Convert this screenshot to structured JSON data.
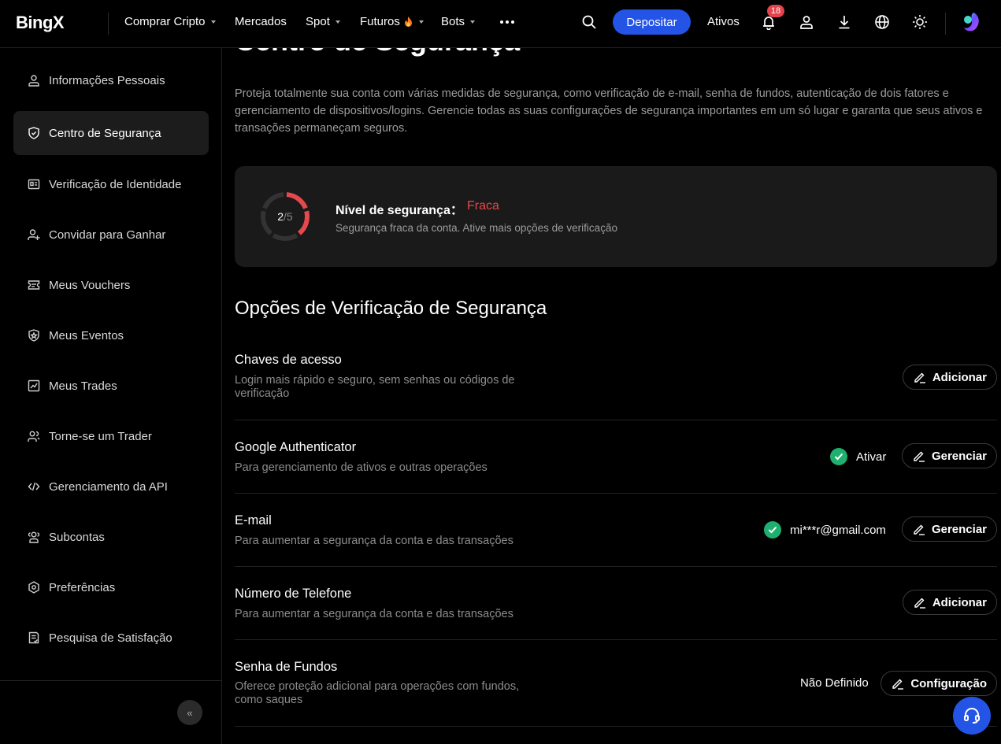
{
  "nav": {
    "logo": "BingX",
    "items": [
      {
        "label": "Comprar Cripto",
        "has_caret": true
      },
      {
        "label": "Mercados",
        "has_caret": false
      },
      {
        "label": "Spot",
        "has_caret": true
      },
      {
        "label": "Futuros",
        "has_caret": true
      },
      {
        "label": "Bots",
        "has_caret": true
      }
    ],
    "more_icon": "more-dots-icon",
    "deposit_label": "Depositar",
    "assets_label": "Ativos",
    "notification_count": "18"
  },
  "sidebar": {
    "items": [
      {
        "label": "Informações Pessoais",
        "icon": "user-icon"
      },
      {
        "label": "Centro de Segurança",
        "icon": "shield-icon",
        "active": true
      },
      {
        "label": "Verificação de Identidade",
        "icon": "id-card-icon"
      },
      {
        "label": "Convidar para Ganhar",
        "icon": "user-plus-icon"
      },
      {
        "label": "Meus Vouchers",
        "icon": "voucher-icon"
      },
      {
        "label": "Meus Eventos",
        "icon": "event-icon"
      },
      {
        "label": "Meus Trades",
        "icon": "chart-icon"
      },
      {
        "label": "Torne-se um Trader",
        "icon": "users-icon"
      },
      {
        "label": "Gerenciamento da API",
        "icon": "code-icon"
      },
      {
        "label": "Subcontas",
        "icon": "subaccount-icon"
      },
      {
        "label": "Preferências",
        "icon": "settings-icon"
      },
      {
        "label": "Pesquisa de Satisfação",
        "icon": "survey-icon"
      }
    ],
    "collapse_label": "«"
  },
  "main": {
    "title": "Centro de Segurança",
    "intro": "Proteja totalmente sua conta com várias medidas de segurança, como verificação de e-mail, senha de fundos, autenticação de dois fatores e gerenciamento de dispositivos/logins. Gerencie todas as suas configurações de segurança importantes em um só lugar e garanta que seus ativos e transações permaneçam seguros.",
    "level": {
      "score": "2",
      "total": "/5",
      "fraction": 0.4,
      "label": "Nível de segurança：",
      "value": "Fraca",
      "value_color": "#e5484d",
      "description": "Segurança fraca da conta. Ative mais opções de verificação"
    },
    "section_title": "Opções de Verificação de Segurança",
    "options": [
      {
        "title": "Chaves de acesso",
        "description": "Login mais rápido e seguro, sem senhas ou códigos de verificação",
        "status": "",
        "button": "Adicionar"
      },
      {
        "title": "Google Authenticator",
        "description": "Para gerenciamento de ativos e outras operações",
        "status": "Ativar",
        "button": "Gerenciar"
      },
      {
        "title": "E-mail",
        "description": "Para aumentar a segurança da conta e das transações",
        "status": "mi***r@gmail.com",
        "button": "Gerenciar"
      },
      {
        "title": "Número de Telefone",
        "description": "Para aumentar a segurança da conta e das transações",
        "status": "",
        "button": "Adicionar"
      },
      {
        "title": "Senha de Fundos",
        "description": "Oferece proteção adicional para operações com fundos, como saques",
        "status": "Não Definido",
        "button": "Configuração"
      }
    ]
  },
  "colors": {
    "accent": "#2354e6",
    "success": "#1fb070",
    "danger": "#e5484d"
  }
}
